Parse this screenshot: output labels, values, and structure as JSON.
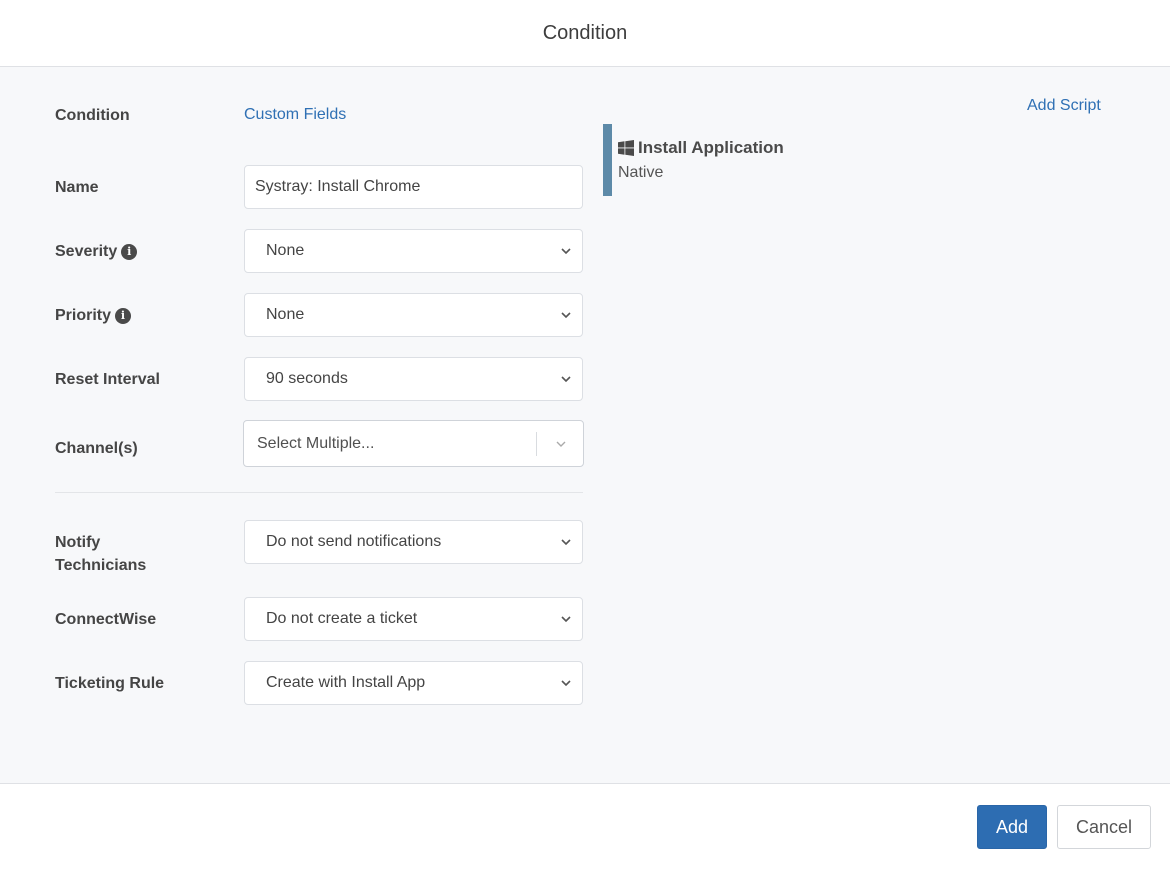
{
  "modal": {
    "title": "Condition"
  },
  "form": {
    "condition_label": "Condition",
    "custom_fields_link": "Custom Fields",
    "add_script_link": "Add Script",
    "name": {
      "label": "Name",
      "value": "Systray: Install Chrome"
    },
    "severity": {
      "label": "Severity",
      "value": "None"
    },
    "priority": {
      "label": "Priority",
      "value": "None"
    },
    "reset_interval": {
      "label": "Reset Interval",
      "value": "90 seconds"
    },
    "channels": {
      "label": "Channel(s)",
      "placeholder": "Select Multiple..."
    },
    "notify_technicians": {
      "label_line1": "Notify",
      "label_line2": "Technicians",
      "value": "Do not send notifications"
    },
    "connectwise": {
      "label": "ConnectWise",
      "value": "Do not create a ticket"
    },
    "ticketing_rule": {
      "label": "Ticketing Rule",
      "value": "Create with Install App"
    }
  },
  "script": {
    "title": "Install Application",
    "subtitle": "Native",
    "icon": "windows-icon",
    "accent_color": "#5d8aa8"
  },
  "footer": {
    "add_label": "Add",
    "cancel_label": "Cancel"
  },
  "colors": {
    "primary": "#2d6db2",
    "link": "#2f70b4",
    "body_bg": "#f7f8fa"
  }
}
